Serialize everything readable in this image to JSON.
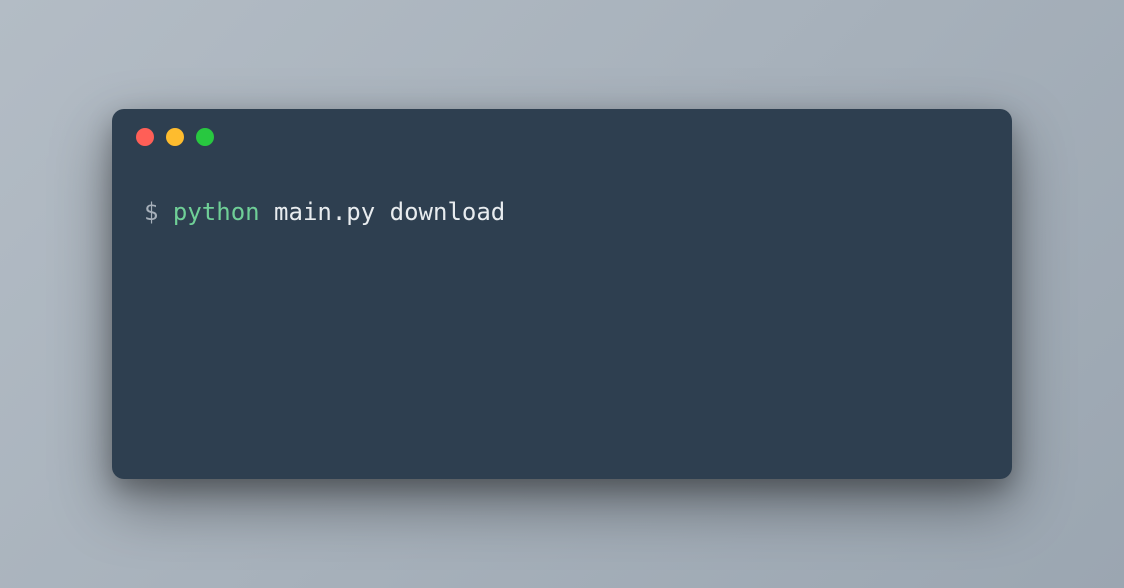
{
  "terminal": {
    "prompt": "$ ",
    "command": "python",
    "args": " main.py download"
  },
  "window_controls": {
    "close": "close",
    "minimize": "minimize",
    "maximize": "maximize"
  }
}
